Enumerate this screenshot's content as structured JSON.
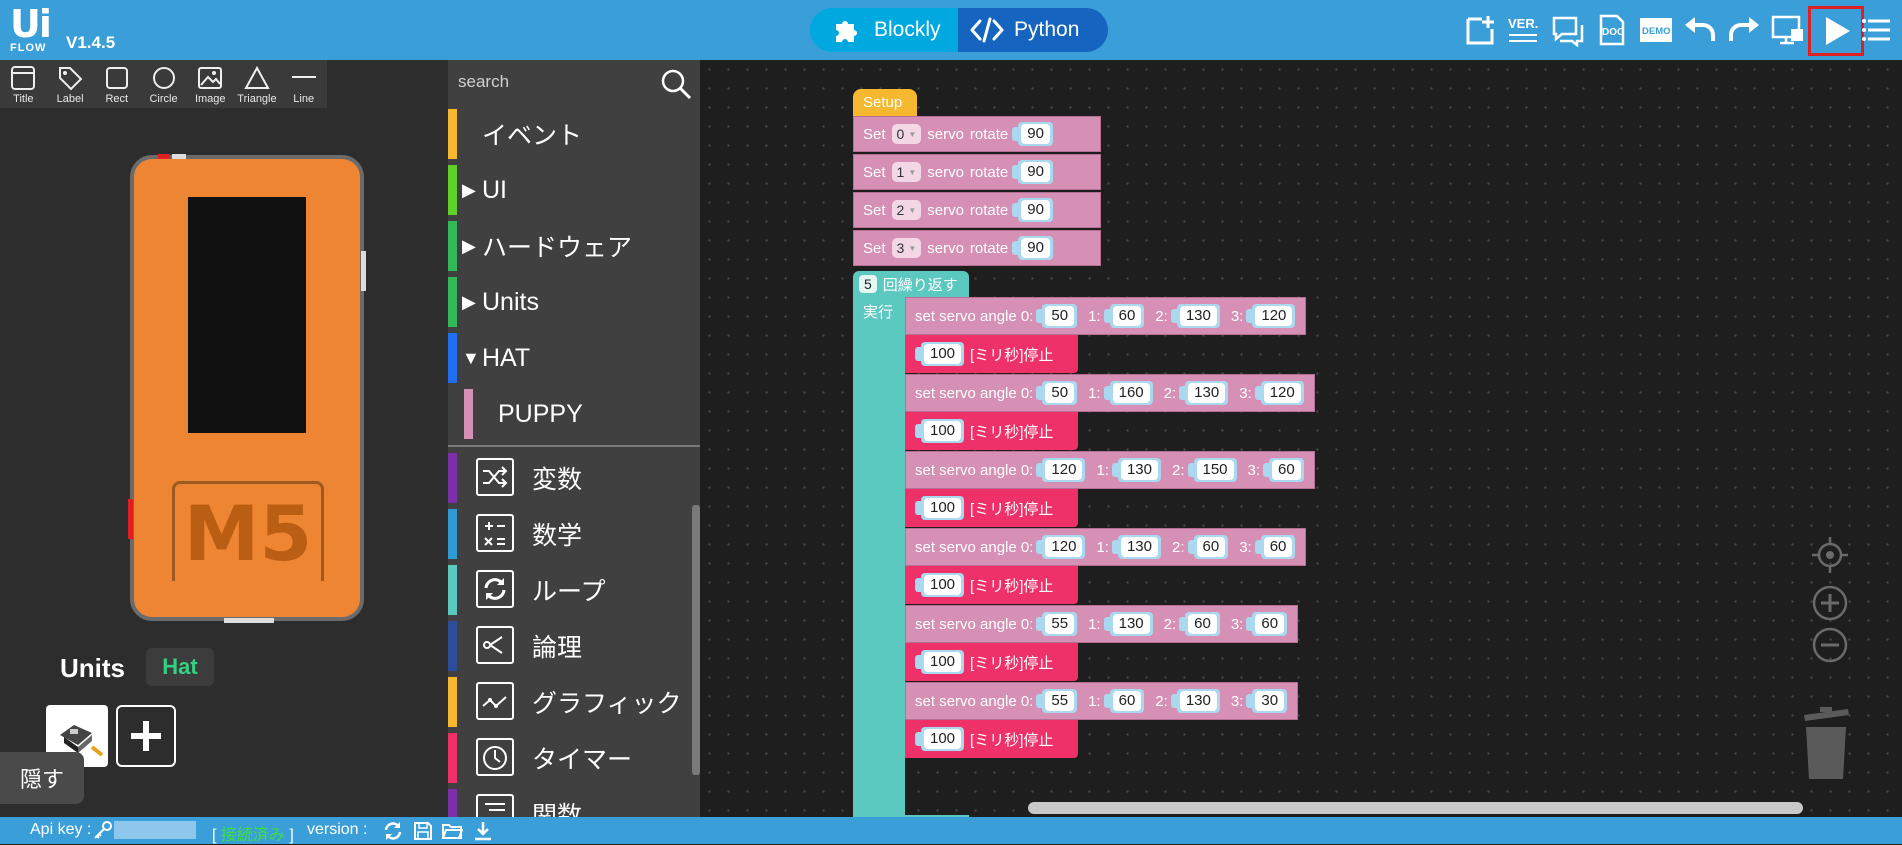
{
  "app": {
    "logo_top": "Ui",
    "logo_bottom": "FLOW",
    "version": "V1.4.5",
    "mode_blockly": "Blockly",
    "mode_python": "Python",
    "tool_ver": "VER.",
    "tool_doc": "DOC",
    "tool_demo": "DEMO"
  },
  "widgets": [
    {
      "label": "Title",
      "icon": "title-widget-icon"
    },
    {
      "label": "Label",
      "icon": "label-widget-icon"
    },
    {
      "label": "Rect",
      "icon": "rect-widget-icon"
    },
    {
      "label": "Circle",
      "icon": "circle-widget-icon"
    },
    {
      "label": "Image",
      "icon": "image-widget-icon"
    },
    {
      "label": "Triangle",
      "icon": "triangle-widget-icon"
    },
    {
      "label": "Line",
      "icon": "line-widget-icon"
    }
  ],
  "device": {
    "logo": "M5"
  },
  "units_panel": {
    "title": "Units",
    "hat_badge": "Hat",
    "hide_button": "隠す"
  },
  "search": {
    "placeholder": "search"
  },
  "categories": {
    "event": "イベント",
    "ui": "UI",
    "hardware": "ハードウェア",
    "units": "Units",
    "hat": "HAT",
    "puppy": "PUPPY",
    "variables": "変数",
    "math": "数学",
    "loop": "ループ",
    "logic": "論理",
    "graphic": "グラフィック",
    "timer": "タイマー",
    "functions": "関数"
  },
  "colors": {
    "topbar": "#3a9fd8",
    "blockly_btn": "#00a8e0",
    "python_btn": "#1565c0",
    "servo_block": "#d68fb5",
    "wait_block": "#ee3169",
    "loop_block": "#5cc9c0",
    "setup_block": "#f5b82e",
    "hat_badge_text": "#35d081",
    "connected_text": "#3de03d"
  },
  "blocks": {
    "setup": "Setup",
    "servo_sets": [
      {
        "set": "Set",
        "port": "0",
        "servo": "servo",
        "rotate": "rotate",
        "value": "90"
      },
      {
        "set": "Set",
        "port": "1",
        "servo": "servo",
        "rotate": "rotate",
        "value": "90"
      },
      {
        "set": "Set",
        "port": "2",
        "servo": "servo",
        "rotate": "rotate",
        "value": "90"
      },
      {
        "set": "Set",
        "port": "3",
        "servo": "servo",
        "rotate": "rotate",
        "value": "90"
      }
    ],
    "loop_count": "5",
    "loop_label": "回繰り返す",
    "exec_label": "実行",
    "angle_prefix": "set servo angle 0:",
    "key1": "1:",
    "key2": "2:",
    "key3": "3:",
    "wait_label": "[ミリ秒]停止",
    "steps": [
      {
        "a0": "50",
        "a1": "60",
        "a2": "130",
        "a3": "120",
        "wait": "100"
      },
      {
        "a0": "50",
        "a1": "160",
        "a2": "130",
        "a3": "120",
        "wait": "100"
      },
      {
        "a0": "120",
        "a1": "130",
        "a2": "150",
        "a3": "60",
        "wait": "100"
      },
      {
        "a0": "120",
        "a1": "130",
        "a2": "60",
        "a3": "60",
        "wait": "100"
      },
      {
        "a0": "55",
        "a1": "130",
        "a2": "60",
        "a3": "60",
        "wait": "100"
      },
      {
        "a0": "55",
        "a1": "60",
        "a2": "130",
        "a3": "30",
        "wait": "100"
      }
    ]
  },
  "statusbar": {
    "api_label": "Api key :",
    "bracket_open": "[",
    "connected": "接続済み",
    "bracket_close": "]",
    "version_label": "version :"
  }
}
